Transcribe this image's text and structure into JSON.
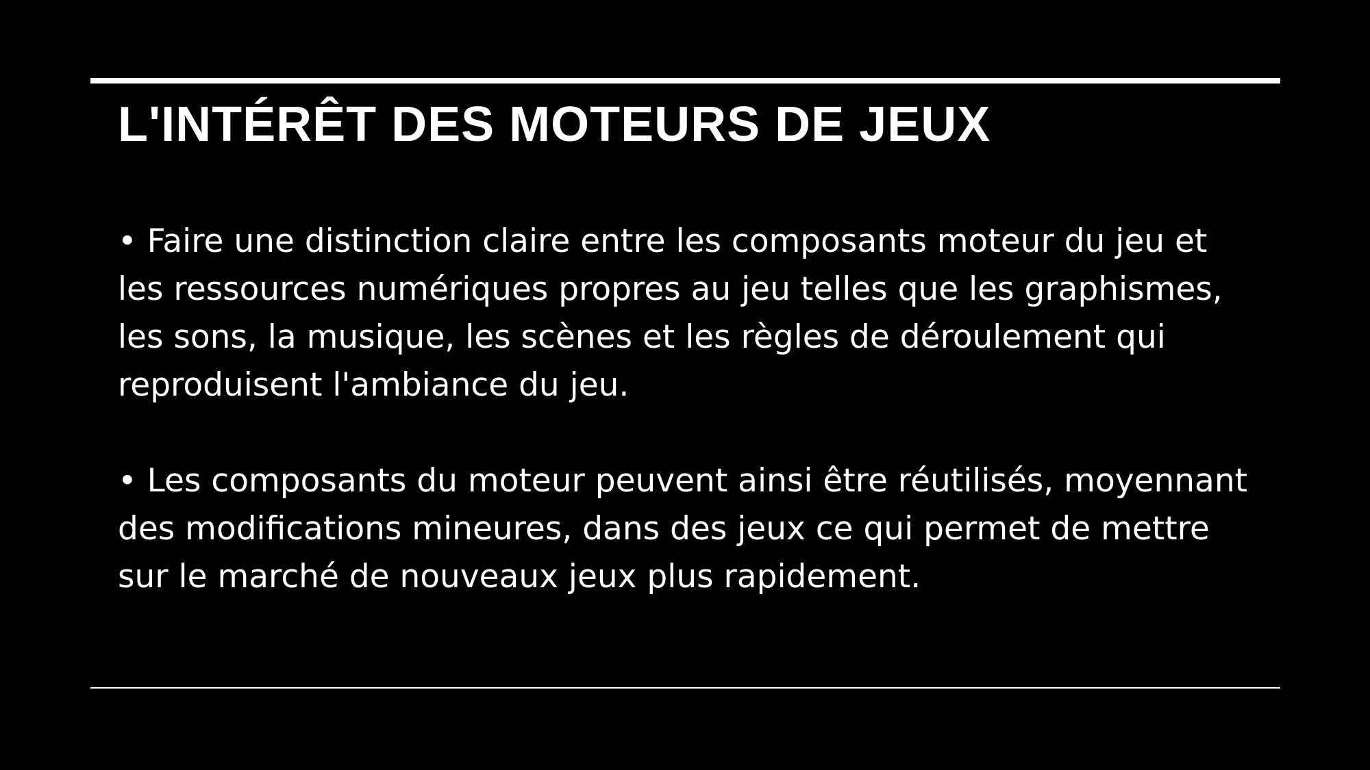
{
  "slide": {
    "title": "L'INTÉRÊT DES MOTEURS DE JEUX",
    "paragraphs": [
      {
        "lines": [
          "• Faire une distinction claire entre les composants moteur du jeu et",
          "les ressources numériques propres au jeu telles que les graphismes,",
          "les sons, la musique, les scènes et les règles de déroulement qui",
          "reproduisent l'ambiance du jeu."
        ]
      },
      {
        "lines": [
          "• Les composants du moteur peuvent ainsi être réutilisés, moyennant",
          "des modifications mineures, dans des jeux ce qui permet de mettre",
          "sur le marché de nouveaux jeux plus rapidement."
        ]
      }
    ]
  },
  "colors": {
    "background": "#000000",
    "text": "#ffffff"
  }
}
